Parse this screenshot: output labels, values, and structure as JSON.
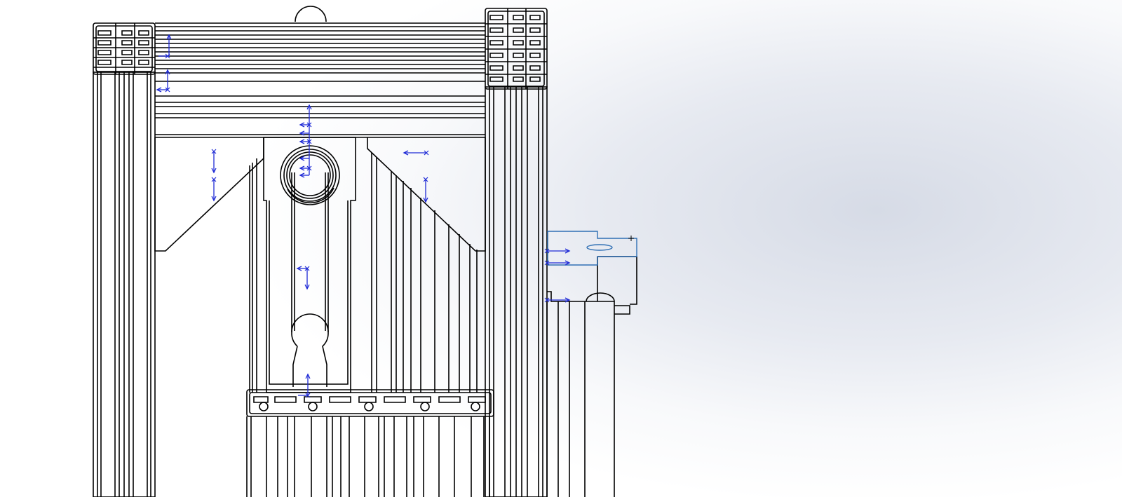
{
  "app": {
    "name": ""
  },
  "viewport": {
    "background_top": "#ffffff",
    "background_mid": "#d6dbe6",
    "model_line_color": "#000000",
    "sketch_line_color": "#1f2bd6",
    "selected_sketch_color": "#2f6fb4"
  },
  "icons": {
    "dimension_arrow": "dimension-arrow-icon",
    "sketch_point": "sketch-point-icon",
    "origin": "origin-icon"
  }
}
